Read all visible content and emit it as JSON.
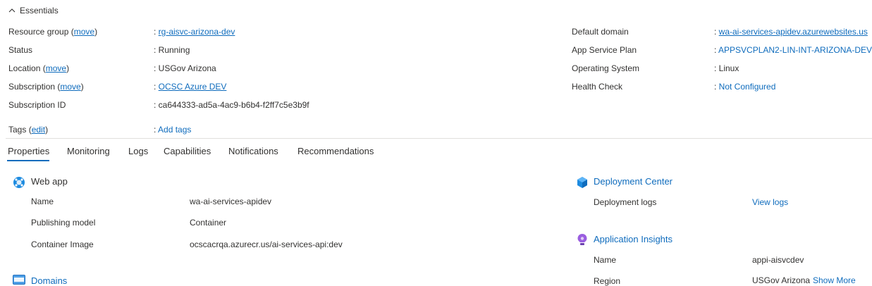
{
  "essentials": {
    "title": "Essentials",
    "left": [
      {
        "label": "Resource group",
        "move": "move",
        "value": "rg-aisvc-arizona-dev"
      },
      {
        "label": "Status",
        "value": "Running"
      },
      {
        "label": "Location",
        "move": "move",
        "value": "USGov Arizona"
      },
      {
        "label": "Subscription",
        "move": "move",
        "value": "OCSC Azure DEV"
      },
      {
        "label": "Subscription ID",
        "value": "ca644333-ad5a-4ac9-b6b4-f2ff7c5e3b9f"
      }
    ],
    "right": [
      {
        "label": "Default domain",
        "value": "wa-ai-services-apidev.azurewebsites.us"
      },
      {
        "label": "App Service Plan",
        "value": "APPSVCPLAN2-LIN-INT-ARIZONA-DEV"
      },
      {
        "label": "Operating System",
        "value": "Linux"
      },
      {
        "label": "Health Check",
        "value": "Not Configured"
      }
    ],
    "tags": {
      "label": "Tags",
      "edit": "edit",
      "value": "Add tags"
    }
  },
  "tabs": [
    "Properties",
    "Monitoring",
    "Logs",
    "Capabilities",
    "Notifications",
    "Recommendations"
  ],
  "web_app": {
    "title": "Web app",
    "rows": [
      {
        "label": "Name",
        "value": "wa-ai-services-apidev"
      },
      {
        "label": "Publishing model",
        "value": "Container"
      },
      {
        "label": "Container Image",
        "value": "ocscacrqa.azurecr.us/ai-services-api:dev"
      }
    ]
  },
  "domains": {
    "title": "Domains"
  },
  "deployment_center": {
    "title": "Deployment Center",
    "rows": [
      {
        "label": "Deployment logs",
        "value": "View logs"
      }
    ]
  },
  "app_insights": {
    "title": "Application Insights",
    "rows": [
      {
        "label": "Name",
        "value": "appi-aisvcdev"
      },
      {
        "label": "Region",
        "value": "USGov Arizona",
        "extra": "Show More"
      }
    ]
  },
  "colors": {
    "link": "#0f6cbd",
    "text": "#323130",
    "divider": "#e1dfdd"
  },
  "icons": [
    "chevron-up-icon",
    "web-app-icon",
    "domains-icon",
    "deployment-center-icon",
    "app-insights-icon"
  ]
}
